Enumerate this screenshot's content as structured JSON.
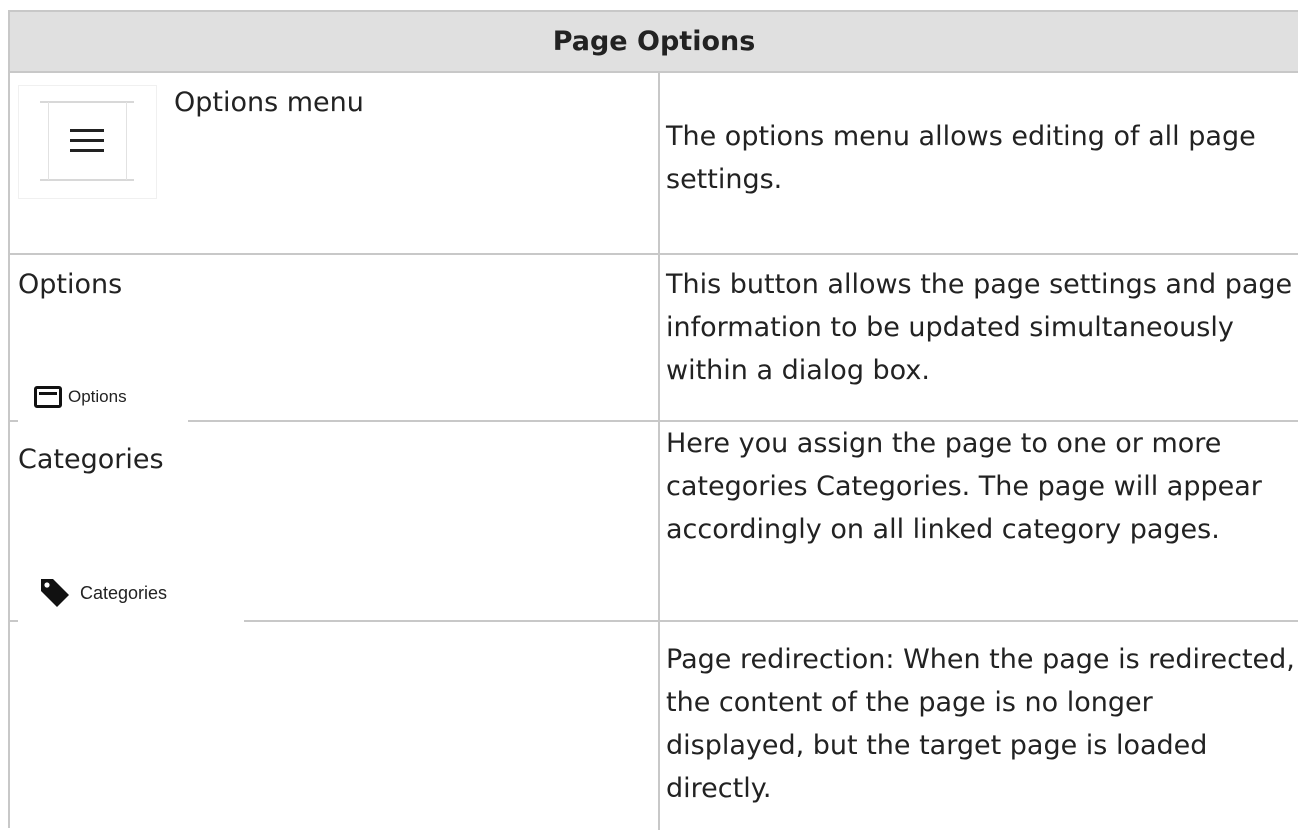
{
  "table": {
    "title": "Page Options",
    "rows": [
      {
        "label": "Options menu",
        "icon": "hamburger-menu-icon",
        "description": "The options menu allows editing of all page settings."
      },
      {
        "label": "Options",
        "button_label": "Options",
        "icon": "window-icon",
        "description": "This button allows the page settings and page information to be updated simultaneously within a dialog box."
      },
      {
        "label": "Categories",
        "button_label": "Categories",
        "icon": "tag-icon",
        "description": "Here you assign the page to one or more categories Categories. The page will appear accordingly on all linked category pages."
      },
      {
        "label": "",
        "description": "Page redirection: When the page is redirected, the content of the page is no longer displayed, but the target page is loaded directly."
      }
    ]
  },
  "colors": {
    "header_bg": "#e0e0e0",
    "border": "#c8c8c8",
    "text": "#222222"
  }
}
